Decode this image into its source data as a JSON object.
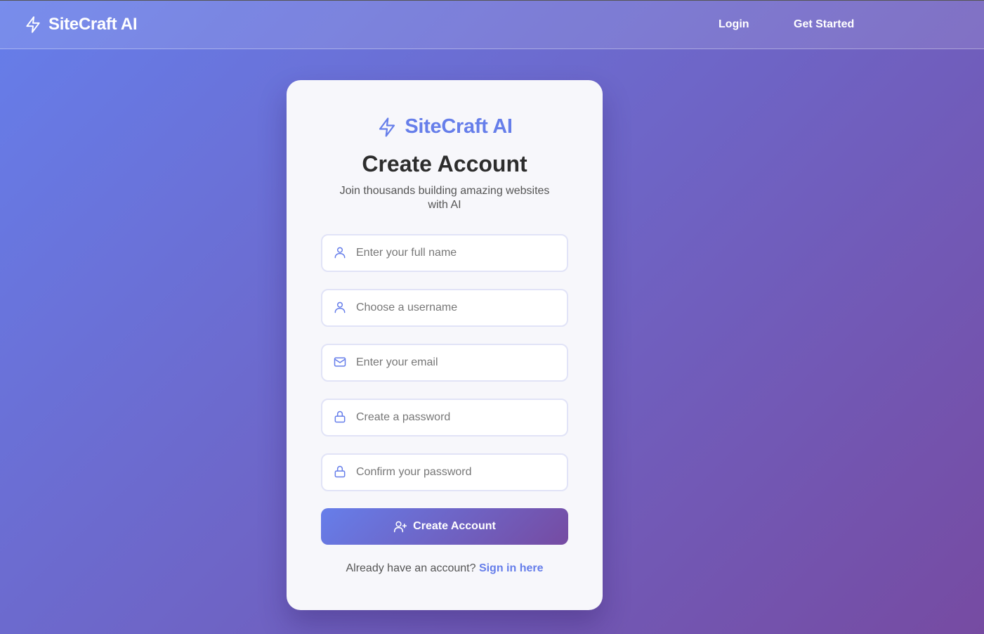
{
  "header": {
    "brand": "SiteCraft AI",
    "nav": {
      "login": "Login",
      "get_started": "Get Started"
    }
  },
  "card": {
    "brand": "SiteCraft AI",
    "title": "Create Account",
    "subtitle": "Join thousands building amazing websites with AI",
    "fields": {
      "full_name": {
        "placeholder": "Enter your full name",
        "icon": "user-icon"
      },
      "username": {
        "placeholder": "Choose a username",
        "icon": "user-icon"
      },
      "email": {
        "placeholder": "Enter your email",
        "icon": "mail-icon"
      },
      "password": {
        "placeholder": "Create a password",
        "icon": "lock-icon"
      },
      "confirm_password": {
        "placeholder": "Confirm your password",
        "icon": "lock-icon"
      }
    },
    "submit_label": "Create Account",
    "submit_icon": "user-plus-icon",
    "footer_text": "Already have an account?",
    "footer_link": "Sign in here"
  },
  "colors": {
    "accent": "#667eea",
    "gradient_end": "#764ba2"
  }
}
